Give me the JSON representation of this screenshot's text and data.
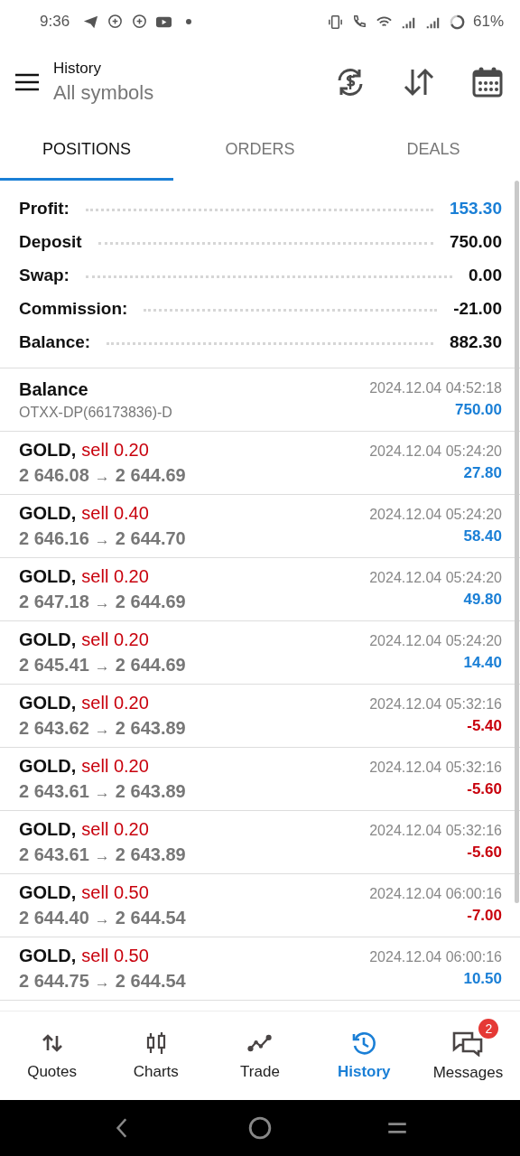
{
  "status_bar": {
    "time": "9:36",
    "battery": "61%"
  },
  "header": {
    "title": "History",
    "subtitle": "All symbols"
  },
  "tabs": [
    {
      "label": "POSITIONS",
      "selected": true
    },
    {
      "label": "ORDERS",
      "selected": false
    },
    {
      "label": "DEALS",
      "selected": false
    }
  ],
  "summary": [
    {
      "label": "Profit:",
      "value": "153.30",
      "highlight": true
    },
    {
      "label": "Deposit",
      "value": "750.00",
      "highlight": false
    },
    {
      "label": "Swap:",
      "value": "0.00",
      "highlight": false
    },
    {
      "label": "Commission:",
      "value": "-21.00",
      "highlight": false
    },
    {
      "label": "Balance:",
      "value": "882.30",
      "highlight": false
    }
  ],
  "entries": [
    {
      "kind": "balance",
      "title": "Balance",
      "detail": "OTXX-DP(66173836)-D",
      "time": "2024.12.04 04:52:18",
      "amount": "750.00",
      "loss": false
    },
    {
      "kind": "trade",
      "symbol": "GOLD,",
      "side": "sell 0.20",
      "open": "2 646.08",
      "arrow": "→",
      "close": "2 644.69",
      "time": "2024.12.04 05:24:20",
      "amount": "27.80",
      "loss": false
    },
    {
      "kind": "trade",
      "symbol": "GOLD,",
      "side": "sell 0.40",
      "open": "2 646.16",
      "arrow": "→",
      "close": "2 644.70",
      "time": "2024.12.04 05:24:20",
      "amount": "58.40",
      "loss": false
    },
    {
      "kind": "trade",
      "symbol": "GOLD,",
      "side": "sell 0.20",
      "open": "2 647.18",
      "arrow": "→",
      "close": "2 644.69",
      "time": "2024.12.04 05:24:20",
      "amount": "49.80",
      "loss": false
    },
    {
      "kind": "trade",
      "symbol": "GOLD,",
      "side": "sell 0.20",
      "open": "2 645.41",
      "arrow": "→",
      "close": "2 644.69",
      "time": "2024.12.04 05:24:20",
      "amount": "14.40",
      "loss": false
    },
    {
      "kind": "trade",
      "symbol": "GOLD,",
      "side": "sell 0.20",
      "open": "2 643.62",
      "arrow": "→",
      "close": "2 643.89",
      "time": "2024.12.04 05:32:16",
      "amount": "-5.40",
      "loss": true
    },
    {
      "kind": "trade",
      "symbol": "GOLD,",
      "side": "sell 0.20",
      "open": "2 643.61",
      "arrow": "→",
      "close": "2 643.89",
      "time": "2024.12.04 05:32:16",
      "amount": "-5.60",
      "loss": true
    },
    {
      "kind": "trade",
      "symbol": "GOLD,",
      "side": "sell 0.20",
      "open": "2 643.61",
      "arrow": "→",
      "close": "2 643.89",
      "time": "2024.12.04 05:32:16",
      "amount": "-5.60",
      "loss": true
    },
    {
      "kind": "trade",
      "symbol": "GOLD,",
      "side": "sell 0.50",
      "open": "2 644.40",
      "arrow": "→",
      "close": "2 644.54",
      "time": "2024.12.04 06:00:16",
      "amount": "-7.00",
      "loss": true
    },
    {
      "kind": "trade",
      "symbol": "GOLD,",
      "side": "sell 0.50",
      "open": "2 644.75",
      "arrow": "→",
      "close": "2 644.54",
      "time": "2024.12.04 06:00:16",
      "amount": "10.50",
      "loss": false
    }
  ],
  "bottom_nav": [
    {
      "label": "Quotes",
      "kind": "quotes",
      "selected": false
    },
    {
      "label": "Charts",
      "kind": "charts",
      "selected": false
    },
    {
      "label": "Trade",
      "kind": "trade",
      "selected": false
    },
    {
      "label": "History",
      "kind": "history",
      "selected": true
    },
    {
      "label": "Messages",
      "kind": "messages",
      "selected": false,
      "badge": "2"
    }
  ]
}
